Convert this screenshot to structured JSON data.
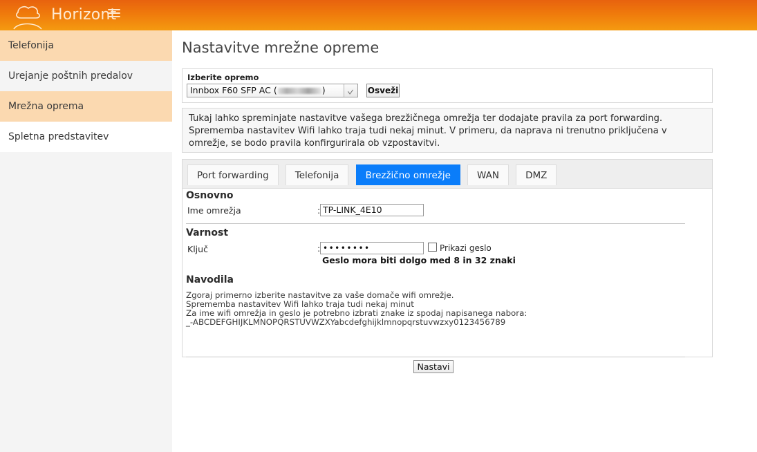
{
  "header": {
    "brand": "Horizont",
    "logo_icon": "cloud-icon",
    "menu_icon": "hamburger-menu-icon"
  },
  "sidebar": {
    "items": [
      {
        "label": "Telefonija",
        "state": "peach"
      },
      {
        "label": "Urejanje poštnih predalov",
        "state": "gray"
      },
      {
        "label": "Mrežna oprema",
        "state": "peach"
      },
      {
        "label": "Spletna predstavitev",
        "state": "white"
      }
    ]
  },
  "main": {
    "page_title": "Nastavitve mrežne opreme",
    "device_panel": {
      "label": "Izberite opremo",
      "selected_prefix": "Innbox F60 SFP AC (",
      "selected_suffix": ")",
      "redacted": true,
      "refresh_label": "Osveži",
      "dropdown_icon": "chevron-down-icon"
    },
    "info_text": "Tukaj lahko spreminjate nastavitve vašega brezžičnega omrežja ter dodajate pravila za port forwarding. Sprememba nastavitev Wifi lahko traja tudi nekaj minut. V primeru, da naprava ni trenutno priključena v omrežje, se bodo pravila konfirgurirala ob vzpostavitvi.",
    "tabs": [
      {
        "label": "Port forwarding",
        "active": false
      },
      {
        "label": "Telefonija",
        "active": false
      },
      {
        "label": "Brezžično omrežje",
        "active": true
      },
      {
        "label": "WAN",
        "active": false
      },
      {
        "label": "DMZ",
        "active": false
      }
    ],
    "form": {
      "basic_section_title": "Osnovno",
      "network_name_label": "Ime omrežja",
      "network_name_value": "TP-LINK_4E10",
      "security_section_title": "Varnost",
      "key_label": "Ključ",
      "key_value": "••••••••",
      "show_password_label": "Prikazi geslo",
      "show_password_checked": false,
      "password_hint": "Geslo mora biti dolgo med 8 in 32 znaki",
      "colon": ":",
      "instructions_title": "Navodila",
      "instructions_line1": "Zgoraj primerno izberite nastavitve za vaše domače wifi omrežje.",
      "instructions_line2": "Sprememba nastavitev Wifi lahko traja tudi nekaj minut",
      "instructions_line3": "Za ime wifi omrežja in geslo je potrebno izbrati znake iz spodaj napisanega nabora:",
      "instructions_charset": "_-ABCDEFGHIJKLMNOPQRSTUVWZXYabcdefghijklmnopqrstuvwzxy0123456789",
      "submit_label": "Nastavi"
    }
  },
  "colors": {
    "header_start": "#e8620e",
    "header_end": "#f59a10",
    "sidebar_highlight": "#fbd9b0",
    "tab_active": "#0a7dfa"
  }
}
